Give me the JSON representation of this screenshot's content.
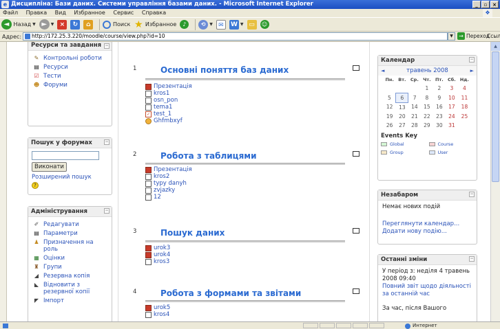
{
  "window": {
    "title": "Дисципліна: Бази даних. Системи управління базами даних. - Microsoft Internet Explorer"
  },
  "menu": [
    "Файл",
    "Правка",
    "Вид",
    "Избранное",
    "Сервис",
    "Справка"
  ],
  "toolbar": {
    "back": "Назад",
    "search": "Поиск",
    "favorites": "Избранное"
  },
  "address": {
    "label": "Адрес:",
    "url": "http://172.25.3.220/moodle/course/view.php?id=10",
    "go": "Переход",
    "links": "Ссылки"
  },
  "left": {
    "resources": {
      "title": "Ресурси та завдання",
      "items": [
        "Контрольні роботи",
        "Ресурси",
        "Тести",
        "Форуми"
      ]
    },
    "forum_search": {
      "title": "Пошук у форумах",
      "button": "Виконати",
      "advanced": "Розширений пошук",
      "input": ""
    },
    "admin": {
      "title": "Адміністрування",
      "items": [
        "Редагувати",
        "Параметри",
        "Призначення на роль",
        "Оцінки",
        "Групи",
        "Резервна копія",
        "Відновити з резервної копії",
        "Імпорт"
      ]
    }
  },
  "topics": [
    {
      "num": "1",
      "title": "Основні поняття баз даних",
      "items": [
        "Презентація",
        "kros1",
        "osn_pon",
        "tema1",
        "test_1",
        "Ghfmbxyf"
      ]
    },
    {
      "num": "2",
      "title": "Робота з таблицями",
      "items": [
        "Презентація",
        "kros2",
        "typy danyh",
        "zvjazky",
        "12"
      ]
    },
    {
      "num": "3",
      "title": "Пошук даних",
      "items": [
        "urok3",
        "urok4",
        "kros3"
      ]
    },
    {
      "num": "4",
      "title": "Робота з формами та звітами",
      "items": [
        "urok5",
        "kros4"
      ]
    }
  ],
  "calendar": {
    "title": "Календар",
    "month": "травень 2008",
    "prev": "◄",
    "next": "►",
    "weekdays": [
      "Пн.",
      "Вт.",
      "Ср.",
      "Чт.",
      "Пт.",
      "Сб.",
      "Нд."
    ],
    "weeks": [
      [
        "",
        "",
        "",
        "1",
        "2",
        "3",
        "4"
      ],
      [
        "5",
        "6",
        "7",
        "8",
        "9",
        "10",
        "11"
      ],
      [
        "12",
        "13",
        "14",
        "15",
        "16",
        "17",
        "18"
      ],
      [
        "19",
        "20",
        "21",
        "22",
        "23",
        "24",
        "25"
      ],
      [
        "26",
        "27",
        "28",
        "29",
        "30",
        "31",
        ""
      ]
    ],
    "today": "6",
    "event_key": "Events Key",
    "events": {
      "global": "Global",
      "course": "Course",
      "group": "Group",
      "user": "User"
    },
    "event_colors": {
      "global": "#d4f6d4",
      "course": "#f6d4d4",
      "group": "#f6e8c8",
      "user": "#dde8fa"
    }
  },
  "upcoming": {
    "title": "Незабаром",
    "none": "Немає нових подій",
    "goto": "Переглянути календар...",
    "add": "Додати нову подію..."
  },
  "recent": {
    "title": "Останні зміни",
    "since": "У період з: неділя 4 травень 2008 09:40",
    "full": "Повний звіт щодо діяльності за останній час",
    "after": "За час, після Вашого"
  },
  "status": {
    "zone": "Интернет"
  }
}
